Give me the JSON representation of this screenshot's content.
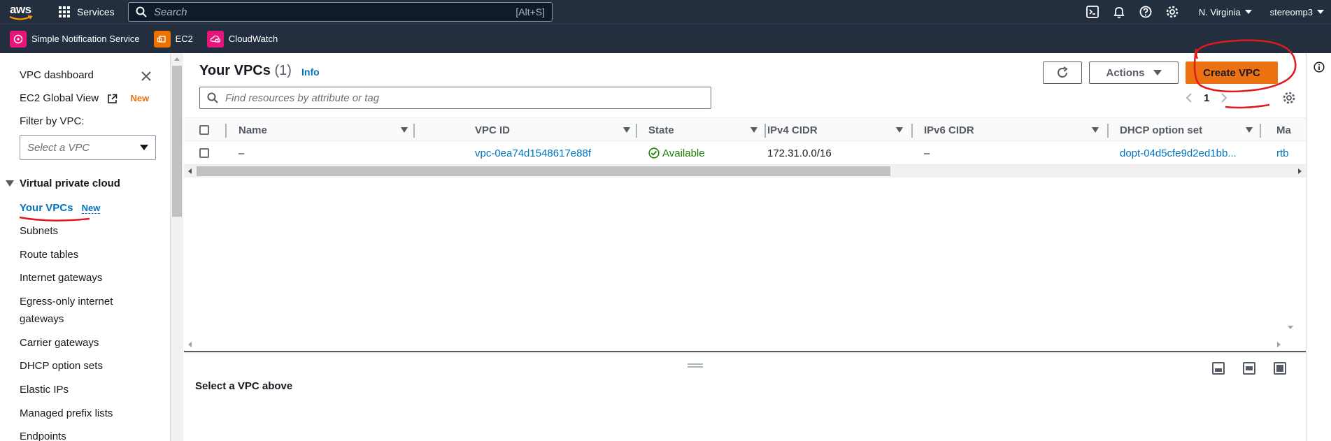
{
  "topnav": {
    "logo": "aws",
    "services_label": "Services",
    "search_placeholder": "Search",
    "search_shortcut": "[Alt+S]",
    "region": "N. Virginia",
    "account": "stereomp3"
  },
  "favorites": [
    {
      "label": "Simple Notification Service",
      "color": "#e7157b"
    },
    {
      "label": "EC2",
      "color": "#ed7100"
    },
    {
      "label": "CloudWatch",
      "color": "#e7157b"
    }
  ],
  "sidebar": {
    "dashboard": "VPC dashboard",
    "ec2_global_view": "EC2 Global View",
    "new_badge": "New",
    "filter_label": "Filter by VPC:",
    "filter_placeholder": "Select a VPC",
    "section_title": "Virtual private cloud",
    "active_item": "Your VPCs",
    "active_new": "New",
    "items": [
      "Subnets",
      "Route tables",
      "Internet gateways",
      "Egress-only internet",
      "gateways",
      "Carrier gateways",
      "DHCP option sets",
      "Elastic IPs",
      "Managed prefix lists",
      "Endpoints"
    ]
  },
  "main": {
    "title": "Your VPCs",
    "count": "(1)",
    "info": "Info",
    "actions": "Actions",
    "create": "Create VPC",
    "filter_placeholder": "Find resources by attribute or tag",
    "page": "1",
    "columns": [
      "Name",
      "VPC ID",
      "State",
      "IPv4 CIDR",
      "IPv6 CIDR",
      "DHCP option set",
      "Ma"
    ],
    "row": {
      "name": "–",
      "vpc_id": "vpc-0ea74d1548617e88f",
      "state": "Available",
      "ipv4": "172.31.0.0/16",
      "ipv6": "–",
      "dhcp": "dopt-04d5cfe9d2ed1bb...",
      "main_rt": "rtb"
    },
    "detail_empty": "Select a VPC above"
  },
  "colors": {
    "nav_bg": "#232f3e",
    "accent": "#ec7211",
    "link": "#0073bb",
    "success": "#1d8102",
    "annotation": "#e0191d"
  }
}
